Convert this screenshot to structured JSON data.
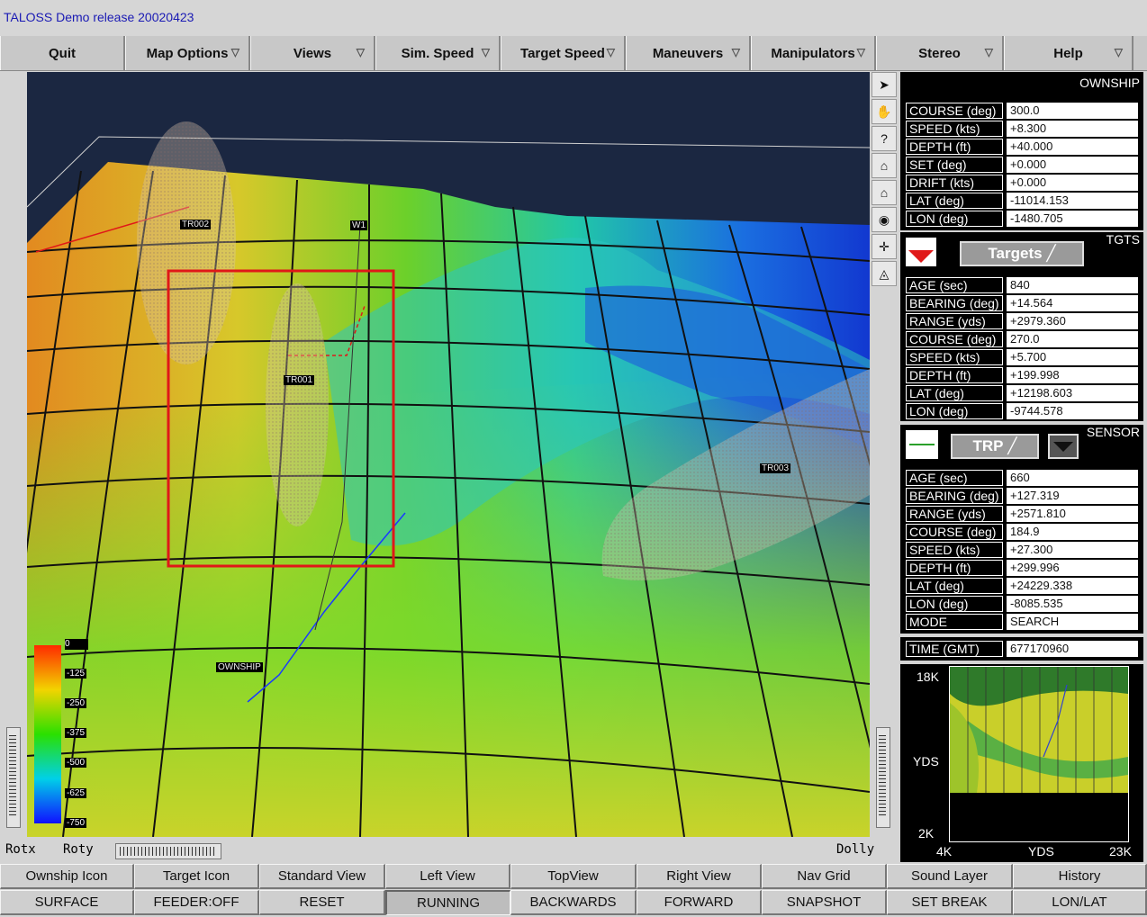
{
  "app": {
    "title": "TALOSS Demo release 20020423"
  },
  "menus": [
    {
      "label": "Quit",
      "arrow": ""
    },
    {
      "label": "Map Options",
      "arrow": "▽"
    },
    {
      "label": "Views",
      "arrow": "▽"
    },
    {
      "label": "Sim. Speed",
      "arrow": "▽"
    },
    {
      "label": "Target Speed",
      "arrow": "▽"
    },
    {
      "label": "Maneuvers",
      "arrow": "▽"
    },
    {
      "label": "Manipulators",
      "arrow": "▽"
    },
    {
      "label": "Stereo",
      "arrow": "▽"
    },
    {
      "label": "Help",
      "arrow": "▽"
    }
  ],
  "viewport": {
    "labels": {
      "tr001": "TR001",
      "tr002": "TR002",
      "tr003": "TR003",
      "w1": "W1",
      "ownship": "OWNSHIP"
    },
    "depth_legend": [
      "0",
      "-125",
      "-250",
      "-375",
      "-500",
      "-625",
      "-750"
    ]
  },
  "tools": [
    "pointer-icon",
    "hand-icon",
    "question-icon",
    "home-icon",
    "home-set-icon",
    "eye-icon",
    "crosshair-icon",
    "perspective-icon"
  ],
  "ownship": {
    "header": "OWNSHIP",
    "rows": [
      {
        "label": "COURSE (deg)",
        "value": "300.0"
      },
      {
        "label": "SPEED (kts)",
        "value": "+8.300"
      },
      {
        "label": "DEPTH (ft)",
        "value": "+40.000"
      },
      {
        "label": "SET (deg)",
        "value": "+0.000"
      },
      {
        "label": "DRIFT (kts)",
        "value": "+0.000"
      },
      {
        "label": "LAT (deg)",
        "value": "-11014.153"
      },
      {
        "label": "LON (deg)",
        "value": "-1480.705"
      }
    ]
  },
  "targets": {
    "header": "TGTS",
    "selector": "Targets",
    "rows": [
      {
        "label": "AGE (sec)",
        "value": "840"
      },
      {
        "label": "BEARING (deg)",
        "value": "+14.564"
      },
      {
        "label": "RANGE (yds)",
        "value": "+2979.360"
      },
      {
        "label": "COURSE (deg)",
        "value": "270.0"
      },
      {
        "label": "SPEED (kts)",
        "value": "+5.700"
      },
      {
        "label": "DEPTH (ft)",
        "value": "+199.998"
      },
      {
        "label": "LAT (deg)",
        "value": "+12198.603"
      },
      {
        "label": "LON (deg)",
        "value": "-9744.578"
      }
    ]
  },
  "sensor": {
    "header": "SENSOR",
    "selector": "TRP",
    "rows": [
      {
        "label": "AGE (sec)",
        "value": "660"
      },
      {
        "label": "BEARING (deg)",
        "value": "+127.319"
      },
      {
        "label": "RANGE (yds)",
        "value": "+2571.810"
      },
      {
        "label": "COURSE (deg)",
        "value": "184.9"
      },
      {
        "label": "SPEED (kts)",
        "value": "+27.300"
      },
      {
        "label": "DEPTH (ft)",
        "value": "+299.996"
      },
      {
        "label": "LAT (deg)",
        "value": "+24229.338"
      },
      {
        "label": "LON (deg)",
        "value": "-8085.535"
      },
      {
        "label": "MODE",
        "value": "SEARCH"
      }
    ]
  },
  "time": {
    "label": "TIME (GMT)",
    "value": "677170960"
  },
  "minimap": {
    "y_top": "18K",
    "y_mid": "YDS",
    "y_bot": "2K",
    "x_left": "4K",
    "x_mid": "YDS",
    "x_right": "23K"
  },
  "nav": {
    "rotx": "Rotx",
    "roty": "Roty",
    "dolly": "Dolly"
  },
  "bottom_row1": [
    "Ownship Icon",
    "Target Icon",
    "Standard View",
    "Left View",
    "TopView",
    "Right View",
    "Nav Grid",
    "Sound Layer",
    "History"
  ],
  "bottom_row2": [
    "SURFACE",
    "FEEDER:OFF",
    "RESET",
    "RUNNING",
    "BACKWARDS",
    "FORWARD",
    "SNAPSHOT",
    "SET BREAK",
    "LON/LAT"
  ],
  "colors": {
    "accent_red": "#e01818",
    "panel_bg": "#000000",
    "title_text": "#1a1ab4"
  }
}
